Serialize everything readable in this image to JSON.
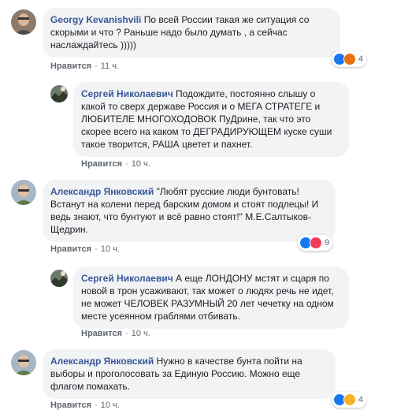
{
  "comments": [
    {
      "author": "Georgy Kevanishvili",
      "text": "По всей России такая же ситуация со скорыми и что ? Раньше надо было думать , а сейчас наслаждайтесь )))))",
      "like_label": "Нравится",
      "time": "11 ч.",
      "reaction_count": "4"
    },
    {
      "author": "Сергей Николаевич",
      "text": "Подождите, постоянно слышу о какой то сверх державе Россия и о МЕГА СТРАТЕГЕ и ЛЮБИТЕЛЕ МНОГОХОДОВОК ПуДрине, так что это скорее всего на каком то ДЕГРАДИРУЮЩЕМ куске суши такое творится, РАША цветет и пахнет.",
      "like_label": "Нравится",
      "time": "10 ч."
    },
    {
      "author": "Александр Янковский",
      "text": "\"Любят русские люди бунтовать! Встанут на колени перед барским домом и стоят подлецы! И ведь знают, что бунтуют и всё равно стоят!\" М.Е.Салтыков-Щедрин.",
      "like_label": "Нравится",
      "time": "10 ч.",
      "reaction_count": "9"
    },
    {
      "author": "Сергей Николаевич",
      "text": "А еще ЛОНДОНУ мстят и сцаря по новой в трон усаживают, так может о людях речь не идет, не может ЧЕЛОВЕК РАЗУМНЫЙ 20 лет чечетку на одном месте усеянном граблями отбивать.",
      "like_label": "Нравится",
      "time": "10 ч."
    },
    {
      "author": "Александр Янковский",
      "text": "Нужно в качестве бунта пойти на выборы и проголосовать за Единую Россию. Можно еще флагом помахать.",
      "like_label": "Нравится",
      "time": "10 ч.",
      "reaction_count": "4"
    }
  ],
  "colors": {
    "author": "#385898",
    "bubble": "#f2f3f5",
    "like_blue": "#1877f2",
    "heart_red": "#f33e58",
    "haha_yellow": "#f7b125",
    "angry_orange": "#e9710f"
  }
}
